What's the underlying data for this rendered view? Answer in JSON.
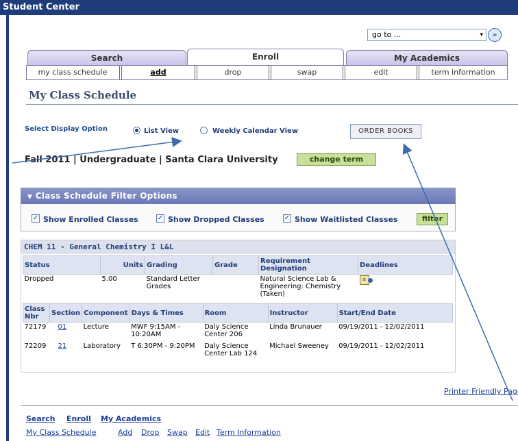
{
  "window": {
    "title": "Student Center"
  },
  "goto": {
    "value": "go to ...",
    "arrow": "▾",
    "go_icon": "»"
  },
  "tabs": [
    {
      "label": "Search"
    },
    {
      "label": "Enroll",
      "active": true
    },
    {
      "label": "My Academics"
    }
  ],
  "subtabs": [
    {
      "label": "my class schedule"
    },
    {
      "label": "add",
      "selected": true
    },
    {
      "label": "drop"
    },
    {
      "label": "swap"
    },
    {
      "label": "edit"
    },
    {
      "label": "term information"
    }
  ],
  "page_title": "My Class Schedule",
  "display_option": {
    "label": "Select Display Option",
    "list_view": "List View",
    "weekly_view": "Weekly Calendar View",
    "selected": "list_view"
  },
  "order_books": "ORDER BOOKS",
  "term": {
    "text": "Fall 2011 | Undergraduate | Santa Clara University",
    "change_label": "change term"
  },
  "filter": {
    "title": "Class Schedule Filter Options",
    "enrolled": "Show Enrolled Classes",
    "dropped": "Show Dropped Classes",
    "waitlisted": "Show Waitlisted Classes",
    "button": "filter"
  },
  "class": {
    "title": "CHEM 11 - General Chemistry I L&L",
    "status_headers": [
      "Status",
      "Units",
      "Grading",
      "Grade",
      "Requirement Designation",
      "Deadlines"
    ],
    "status_row": {
      "status": "Dropped",
      "units": "5.00",
      "grading": "Standard Letter Grades",
      "grade": "",
      "requirement": "Natural Science Lab & Engineering: Chemistry (Taken)"
    },
    "section_headers": [
      "Class Nbr",
      "Section",
      "Component",
      "Days & Times",
      "Room",
      "Instructor",
      "Start/End Date"
    ],
    "sections": [
      {
        "nbr": "72179",
        "section": "01",
        "component": "Lecture",
        "days": "MWF 9:15AM - 10:20AM",
        "room": "Daly Science Center 206",
        "instructor": "Linda Brunauer",
        "dates": "09/19/2011 - 12/02/2011"
      },
      {
        "nbr": "72209",
        "section": "21",
        "component": "Laboratory",
        "days": "T 6:30PM - 9:20PM",
        "room": "Daly Science Center Lab 124",
        "instructor": "Michael Sweeney",
        "dates": "09/19/2011 - 12/02/2011"
      }
    ]
  },
  "printer_friendly": "Printer Friendly Page",
  "bottom_nav": {
    "main": [
      "Search",
      "Enroll",
      "My Academics"
    ],
    "sub": [
      "My Class Schedule",
      "Add",
      "Drop",
      "Swap",
      "Edit",
      "Term Information"
    ]
  },
  "colors": {
    "header": "#1f3d7a",
    "accent_green": "#c9e09a",
    "link": "#1a3d99"
  }
}
